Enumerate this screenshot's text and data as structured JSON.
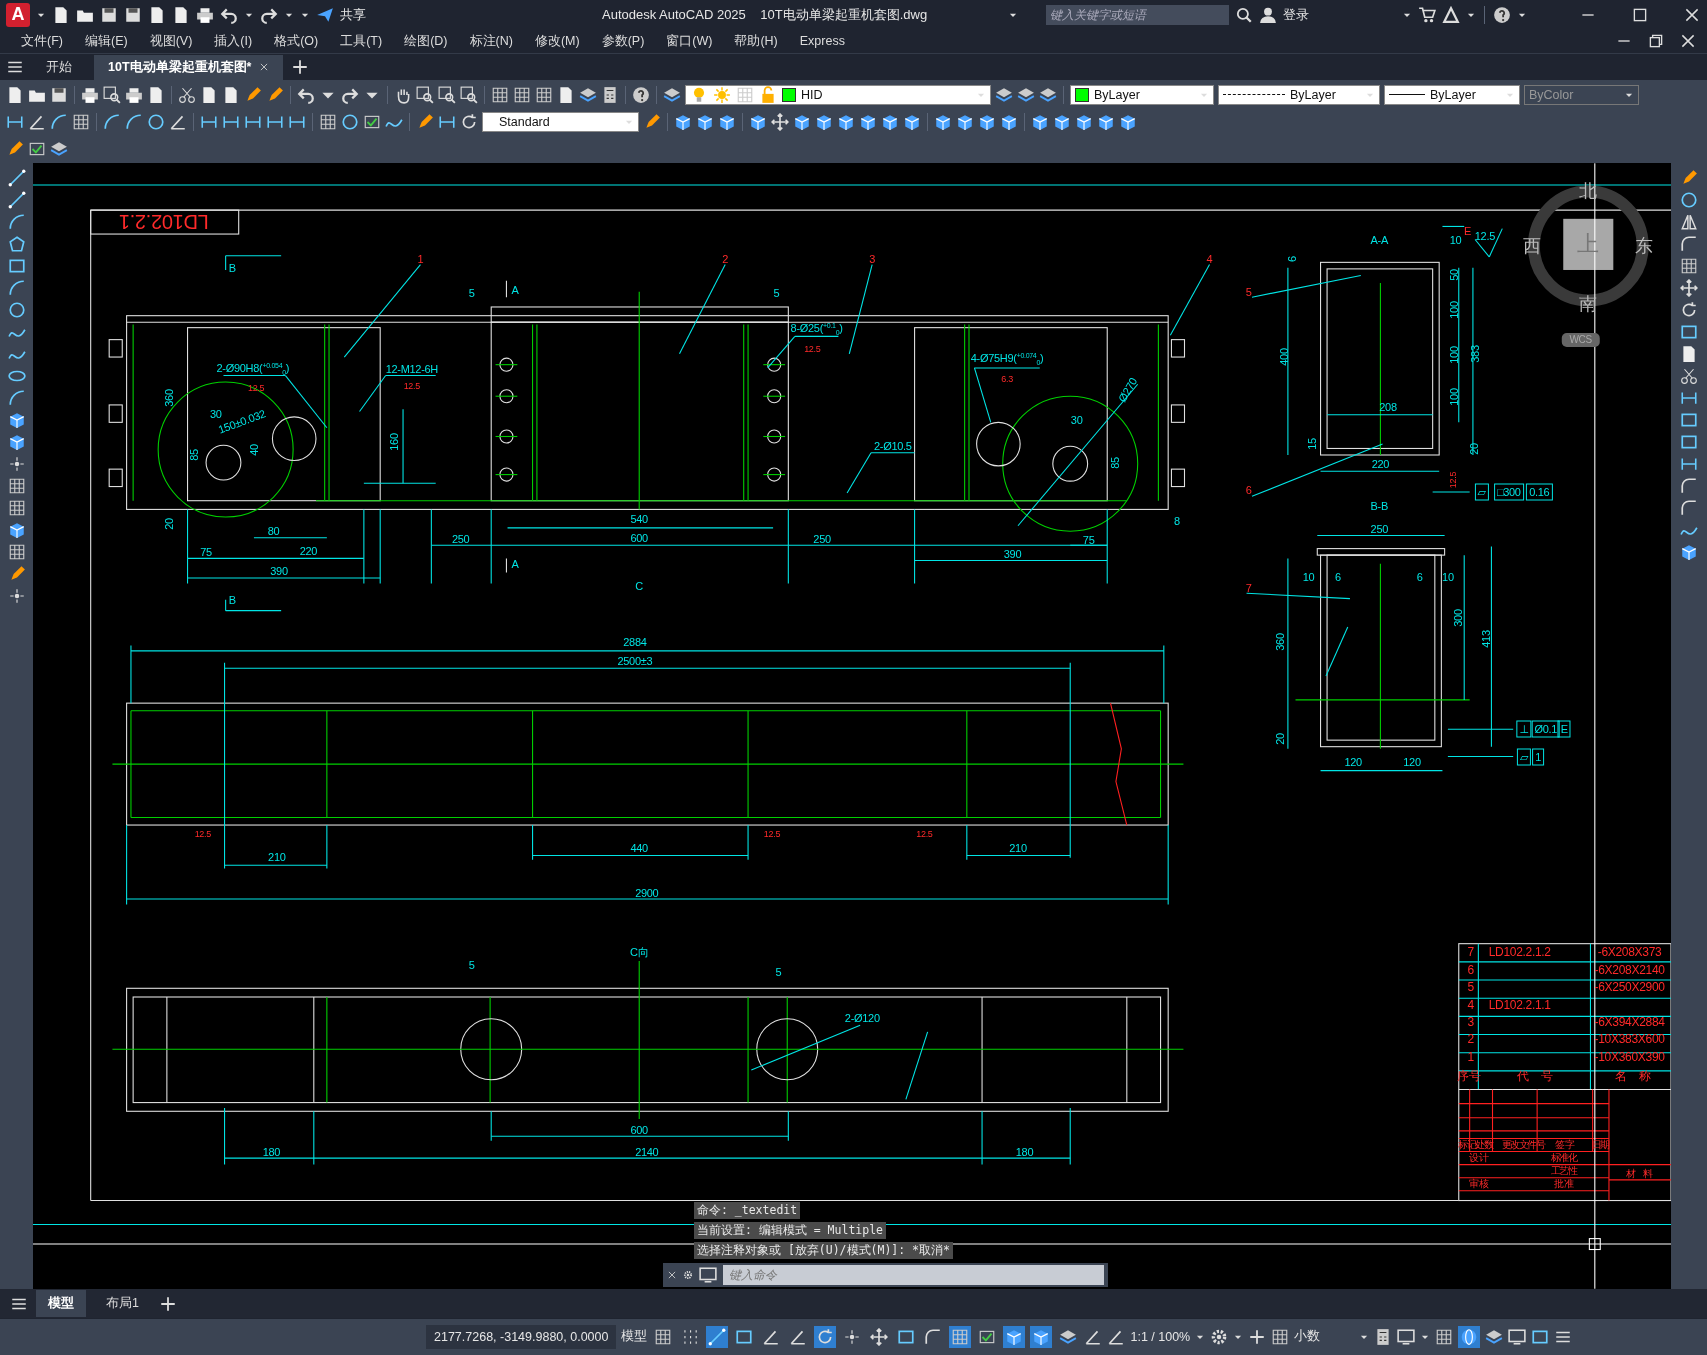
{
  "title_bar": {
    "logo": "A",
    "share": "共享",
    "title": "Autodesk AutoCAD 2025    10T电动单梁起重机套图.dwg",
    "search": {
      "placeholder": "键入关键字或短语"
    },
    "sign_in": "登录"
  },
  "menu_bar": [
    "文件(F)",
    "编辑(E)",
    "视图(V)",
    "插入(I)",
    "格式(O)",
    "工具(T)",
    "绘图(D)",
    "标注(N)",
    "修改(M)",
    "参数(P)",
    "窗口(W)",
    "帮助(H)",
    "Express"
  ],
  "file_tabs": [
    {
      "label": "开始",
      "selected": false
    },
    {
      "label": "10T电动单梁起重机套图*",
      "selected": true
    }
  ],
  "properties": {
    "layer": "HID",
    "color_setting": "ByLayer",
    "linetype": "ByLayer",
    "lineweight": "ByLayer",
    "plot_style": {
      "value": "ByColor",
      "disabled": true
    },
    "text_style": "Standard"
  },
  "drawing": {
    "labels": [
      {
        "text": "LD102.2.1",
        "kind": "code"
      },
      {
        "text": "B",
        "kind": "view"
      },
      {
        "text": "B",
        "kind": "view"
      },
      {
        "text": "A",
        "kind": "view"
      },
      {
        "text": "A",
        "kind": "view"
      },
      {
        "text": "C",
        "kind": "view"
      },
      {
        "text": "1",
        "kind": "part"
      },
      {
        "text": "2",
        "kind": "part"
      },
      {
        "text": "3",
        "kind": "part"
      },
      {
        "text": "4",
        "kind": "part"
      },
      {
        "text": "5",
        "kind": "part"
      },
      {
        "text": "6",
        "kind": "part"
      },
      {
        "text": "7",
        "kind": "part"
      },
      {
        "text": "5",
        "kind": "dim"
      },
      {
        "text": "5",
        "kind": "dim"
      },
      {
        "text": "2-Ø90H8($^{+0.054}$$_{0}$)",
        "kind": "dim"
      },
      {
        "text": "12-M12-6H",
        "kind": "dim"
      },
      {
        "text": "8-Ø25($^{+0.1}$$_{0}$)",
        "kind": "dim"
      },
      {
        "text": "4-Ø75H9($^{+0.074}$$_{0}$)",
        "kind": "dim"
      },
      {
        "text": "Ø270",
        "kind": "dim"
      },
      {
        "text": "2-Ø10.5",
        "kind": "dim"
      },
      {
        "text": "150±0.032",
        "kind": "dim"
      },
      {
        "text": "30",
        "kind": "dim"
      },
      {
        "text": "40",
        "kind": "dim"
      },
      {
        "text": "85",
        "kind": "dim"
      },
      {
        "text": "360",
        "kind": "dim"
      },
      {
        "text": "160",
        "kind": "dim"
      },
      {
        "text": "20",
        "kind": "dim"
      },
      {
        "text": "80",
        "kind": "dim"
      },
      {
        "text": "75",
        "kind": "dim"
      },
      {
        "text": "220",
        "kind": "dim"
      },
      {
        "text": "390",
        "kind": "dim"
      },
      {
        "text": "540",
        "kind": "dim"
      },
      {
        "text": "250",
        "kind": "dim"
      },
      {
        "text": "600",
        "kind": "dim"
      },
      {
        "text": "250",
        "kind": "dim"
      },
      {
        "text": "390",
        "kind": "dim"
      },
      {
        "text": "75",
        "kind": "dim"
      },
      {
        "text": "30",
        "kind": "dim"
      },
      {
        "text": "85",
        "kind": "dim"
      },
      {
        "text": "8",
        "kind": "dim"
      },
      {
        "text": "12.5",
        "kind": "rough"
      },
      {
        "text": "12.5",
        "kind": "rough"
      },
      {
        "text": "12.5",
        "kind": "rough"
      },
      {
        "text": "6.3",
        "kind": "rough"
      },
      {
        "text": "2884",
        "kind": "dim"
      },
      {
        "text": "2500±3",
        "kind": "dim"
      },
      {
        "text": "12.5",
        "kind": "rough"
      },
      {
        "text": "12.5",
        "kind": "rough"
      },
      {
        "text": "12.5",
        "kind": "rough"
      },
      {
        "text": "210",
        "kind": "dim"
      },
      {
        "text": "440",
        "kind": "dim"
      },
      {
        "text": "210",
        "kind": "dim"
      },
      {
        "text": "2900",
        "kind": "dim"
      },
      {
        "text": "C向",
        "kind": "view"
      },
      {
        "text": "5",
        "kind": "dim"
      },
      {
        "text": "5",
        "kind": "dim"
      },
      {
        "text": "2-Ø120",
        "kind": "dim"
      },
      {
        "text": "600",
        "kind": "dim"
      },
      {
        "text": "180",
        "kind": "dim"
      },
      {
        "text": "2140",
        "kind": "dim"
      },
      {
        "text": "180",
        "kind": "dim"
      },
      {
        "text": "A-A",
        "kind": "view"
      },
      {
        "text": "10",
        "kind": "dim"
      },
      {
        "text": "E",
        "kind": "part"
      },
      {
        "text": "12.5",
        "kind": "dim"
      },
      {
        "text": "6",
        "kind": "dim"
      },
      {
        "text": "400",
        "kind": "dim"
      },
      {
        "text": "50",
        "kind": "dim"
      },
      {
        "text": "100",
        "kind": "dim"
      },
      {
        "text": "100",
        "kind": "dim"
      },
      {
        "text": "100",
        "kind": "dim"
      },
      {
        "text": "383",
        "kind": "dim"
      },
      {
        "text": "208",
        "kind": "dim"
      },
      {
        "text": "15",
        "kind": "dim"
      },
      {
        "text": "20",
        "kind": "dim"
      },
      {
        "text": "220",
        "kind": "dim"
      },
      {
        "text": "12.5",
        "kind": "rough"
      },
      {
        "text": "B-B",
        "kind": "view"
      },
      {
        "text": "250",
        "kind": "dim"
      },
      {
        "text": "10",
        "kind": "dim"
      },
      {
        "text": "6",
        "kind": "dim"
      },
      {
        "text": "6",
        "kind": "dim"
      },
      {
        "text": "10",
        "kind": "dim"
      },
      {
        "text": "300",
        "kind": "dim"
      },
      {
        "text": "413",
        "kind": "dim"
      },
      {
        "text": "360",
        "kind": "dim"
      },
      {
        "text": "20",
        "kind": "dim"
      },
      {
        "text": "120",
        "kind": "dim"
      },
      {
        "text": "120",
        "kind": "dim"
      },
      {
        "text": "▱",
        "kind": "frame"
      },
      {
        "text": "□300",
        "kind": "frame"
      },
      {
        "text": "0.16",
        "kind": "frame"
      },
      {
        "text": "⊥",
        "kind": "frame"
      },
      {
        "text": "Ø0.1",
        "kind": "frame"
      },
      {
        "text": "E",
        "kind": "frame"
      },
      {
        "text": "▱",
        "kind": "frame"
      },
      {
        "text": "1",
        "kind": "frame"
      },
      {
        "text": "北",
        "kind": "compass"
      },
      {
        "text": "西",
        "kind": "compass"
      },
      {
        "text": "上",
        "kind": "cube"
      },
      {
        "text": "东",
        "kind": "compass"
      },
      {
        "text": "南",
        "kind": "compass"
      },
      {
        "text": "WCS",
        "kind": "wcs"
      },
      {
        "text": "7",
        "kind": "table"
      },
      {
        "text": "LD102.2.1.2",
        "kind": "table"
      },
      {
        "text": "-6X208X373",
        "kind": "table"
      },
      {
        "text": "6",
        "kind": "table"
      },
      {
        "text": "-6X208X2140",
        "kind": "table"
      },
      {
        "text": "5",
        "kind": "table"
      },
      {
        "text": "-6X250X2900",
        "kind": "table"
      },
      {
        "text": "4",
        "kind": "table"
      },
      {
        "text": "LD102.2.1.1",
        "kind": "table"
      },
      {
        "text": "3",
        "kind": "table"
      },
      {
        "text": "-6X394X2884",
        "kind": "table"
      },
      {
        "text": "2",
        "kind": "table"
      },
      {
        "text": "-10X383X600",
        "kind": "table"
      },
      {
        "text": "1",
        "kind": "table"
      },
      {
        "text": "-10X360X390",
        "kind": "table"
      },
      {
        "text": "序号",
        "kind": "table"
      },
      {
        "text": "代　号",
        "kind": "table"
      },
      {
        "text": "名　称",
        "kind": "table"
      },
      {
        "text": "标记处数",
        "kind": "small"
      },
      {
        "text": "更改文件号",
        "kind": "small"
      },
      {
        "text": "签 字",
        "kind": "small"
      },
      {
        "text": "日期",
        "kind": "small"
      },
      {
        "text": "设 计",
        "kind": "small"
      },
      {
        "text": "标准化",
        "kind": "small"
      },
      {
        "text": "工艺性",
        "kind": "small"
      },
      {
        "text": "审 核",
        "kind": "small"
      },
      {
        "text": "批 准",
        "kind": "small"
      },
      {
        "text": "材　料",
        "kind": "small"
      }
    ]
  },
  "command_history": [
    "命令: _textedit",
    "当前设置: 编辑模式 = Multiple",
    "选择注释对象或 [放弃(U)/模式(M)]: *取消*"
  ],
  "command_line": {
    "placeholder": "键入命令"
  },
  "layout_tabs": [
    {
      "label": "模型",
      "selected": true
    },
    {
      "label": "布局1",
      "selected": false
    }
  ],
  "status_bar": {
    "coordinates": "2177.7268, -3149.9880, 0.0000",
    "space": "模型",
    "scale": "1:1 / 100%",
    "units": "小数",
    "toggles": [
      {
        "on": false
      },
      {
        "on": false
      },
      {
        "on": true
      },
      {
        "on": false
      },
      {
        "on": false
      },
      {
        "on": false
      },
      {
        "on": true
      },
      {
        "on": false
      },
      {
        "on": false
      },
      {
        "on": false
      },
      {
        "on": false
      },
      {
        "on": true
      },
      {
        "on": false
      },
      {
        "on": true
      },
      {
        "on": true
      },
      {
        "on": false
      }
    ],
    "isolate": {
      "on": true
    }
  }
}
